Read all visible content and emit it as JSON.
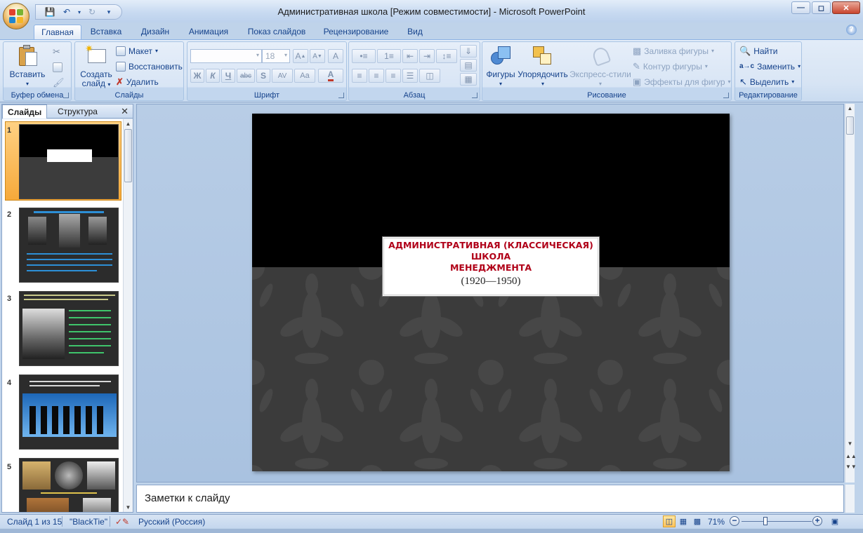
{
  "window": {
    "title": "Административная школа [Режим совместимости] - Microsoft PowerPoint"
  },
  "ribbon_tabs": [
    "Главная",
    "Вставка",
    "Дизайн",
    "Анимация",
    "Показ слайдов",
    "Рецензирование",
    "Вид"
  ],
  "active_tab": "Главная",
  "groups": {
    "clipboard": {
      "label": "Буфер обмена",
      "paste": "Вставить"
    },
    "slides": {
      "label": "Слайды",
      "new_slide_line1": "Создать",
      "new_slide_line2": "слайд",
      "layout": "Макет",
      "reset": "Восстановить",
      "delete": "Удалить"
    },
    "font": {
      "label": "Шрифт",
      "font_name": "",
      "font_size": "18",
      "bold": "Ж",
      "italic": "К",
      "underline": "Ч",
      "strike": "abc",
      "shadow": "S",
      "spacing": "AV",
      "case": "Aa",
      "grow": "A",
      "shrink": "A",
      "clear": "A",
      "color": "A"
    },
    "paragraph": {
      "label": "Абзац"
    },
    "drawing": {
      "label": "Рисование",
      "shapes": "Фигуры",
      "arrange": "Упорядочить",
      "quick_styles": "Экспресс-стили",
      "shape_fill": "Заливка фигуры",
      "shape_outline": "Контур фигуры",
      "shape_effects": "Эффекты для фигур"
    },
    "editing": {
      "label": "Редактирование",
      "find": "Найти",
      "replace": "Заменить",
      "select": "Выделить"
    }
  },
  "panel": {
    "tab_slides": "Слайды",
    "tab_outline": "Структура",
    "thumb_numbers": [
      "1",
      "2",
      "3",
      "4",
      "5"
    ]
  },
  "slide": {
    "title_lines": [
      "АДМИНИСТРАТИВНАЯ (КЛАССИЧЕСКАЯ)",
      "ШКОЛА",
      "МЕНЕДЖМЕНТА"
    ],
    "subtitle": "(1920—1950)"
  },
  "notes_placeholder": "Заметки к слайду",
  "status": {
    "slide_counter": "Слайд 1 из 15",
    "theme": "\"BlackTie\"",
    "language": "Русский (Россия)",
    "zoom": "71%"
  },
  "colors": {
    "title_red": "#b00018",
    "ribbon_blue": "#15428b",
    "selected_thumb": "#f6a93a"
  }
}
